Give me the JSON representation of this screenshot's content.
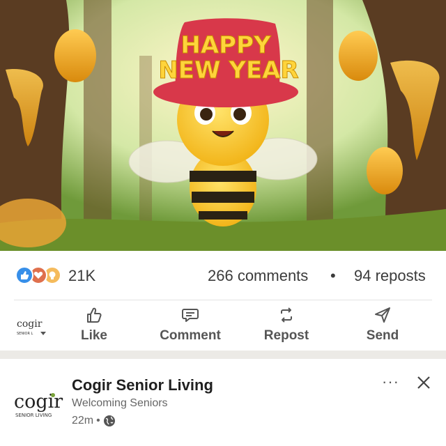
{
  "hero": {
    "hat_text_line1": "HAPPY",
    "hat_text_line2": "NEW YEAR"
  },
  "stats": {
    "reactions": [
      "like-icon",
      "heart-icon",
      "lightbulb-icon"
    ],
    "reaction_count": "21K",
    "comments": "266 comments",
    "separator": "•",
    "reposts": "94 reposts"
  },
  "actions": {
    "avatar_logo": "cogir",
    "avatar_sub": "SENIOR L",
    "like": "Like",
    "comment": "Comment",
    "repost": "Repost",
    "send": "Send"
  },
  "post": {
    "logo_text": "cogir",
    "logo_sub": "SENIOR LIVING",
    "name": "Cogir Senior Living",
    "subtitle": "Welcoming Seniors",
    "time": "22m",
    "time_dot": "•",
    "more": "···",
    "colors": {
      "brand_green": "#7aa33b",
      "link_blue": "#378fe9"
    }
  }
}
